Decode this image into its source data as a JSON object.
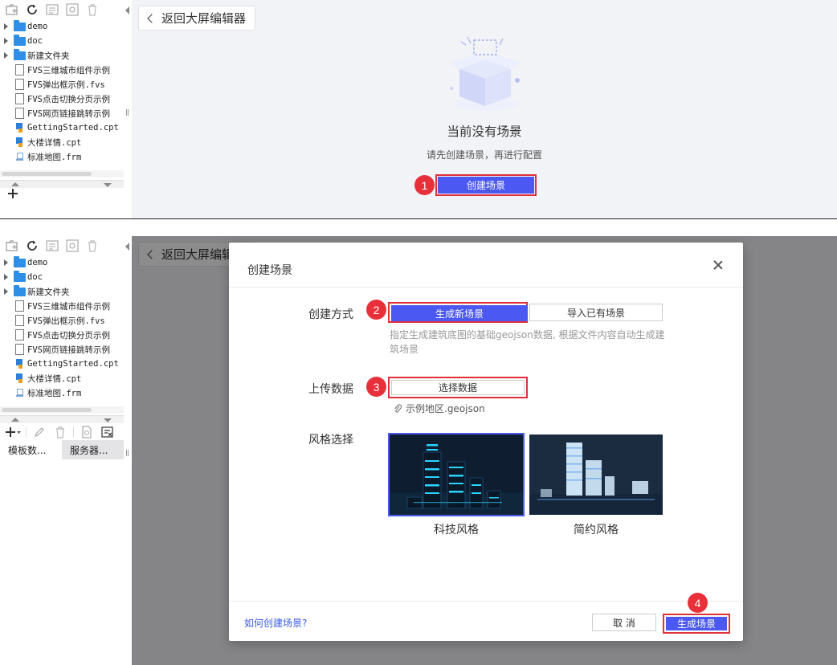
{
  "colors": {
    "primary": "#4b58f2",
    "highlight_border": "#e0303a",
    "badge": "#e8303a",
    "folder": "#2f8ee6",
    "link": "#3a5ae8"
  },
  "sidebar": {
    "toolbar_icons": [
      "new-folder-icon",
      "refresh-icon",
      "report-icon",
      "settings-gear-icon",
      "delete-icon"
    ],
    "items": [
      {
        "label": "demo",
        "type": "folder",
        "expandable": true
      },
      {
        "label": "doc",
        "type": "folder",
        "expandable": true
      },
      {
        "label": "新建文件夹",
        "type": "folder",
        "expandable": true
      },
      {
        "label": "FVS三维城市组件示例",
        "type": "file",
        "expandable": false
      },
      {
        "label": "FVS弹出框示例.fvs",
        "type": "file",
        "expandable": false
      },
      {
        "label": "FVS点击切换分页示例",
        "type": "file",
        "expandable": false
      },
      {
        "label": "FVS网页链接跳转示例",
        "type": "file",
        "expandable": false
      },
      {
        "label": "GettingStarted.cpt",
        "type": "cpt",
        "expandable": false
      },
      {
        "label": "大楼详情.cpt",
        "type": "cpt",
        "expandable": false
      },
      {
        "label": "标准地图.frm",
        "type": "frm",
        "expandable": false
      }
    ],
    "bottom_tools": [
      "add-icon",
      "edit-icon",
      "delete-icon",
      "preview-icon",
      "clear-icon"
    ],
    "tabs": [
      "模板数...",
      "服务器..."
    ]
  },
  "top": {
    "back_label": "返回大屏编辑器",
    "empty_title": "当前没有场景",
    "empty_subtitle": "请先创建场景，再进行配置",
    "create_label": "创建场景",
    "badge": "1"
  },
  "modal": {
    "title": "创建场景",
    "method_label": "创建方式",
    "method_options": [
      "生成新场景",
      "导入已有场景"
    ],
    "method_hint": "指定生成建筑底图的基础geojson数据, 根据文件内容自动生成建筑场景",
    "upload_label": "上传数据",
    "choose_label": "选择数据",
    "file_name": "示例地区.geojson",
    "style_label": "风格选择",
    "styles": [
      "科技风格",
      "简约风格"
    ],
    "help_link": "如何创建场景?",
    "cancel_label": "取 消",
    "generate_label": "生成场景",
    "badges": [
      "2",
      "3",
      "4"
    ]
  }
}
